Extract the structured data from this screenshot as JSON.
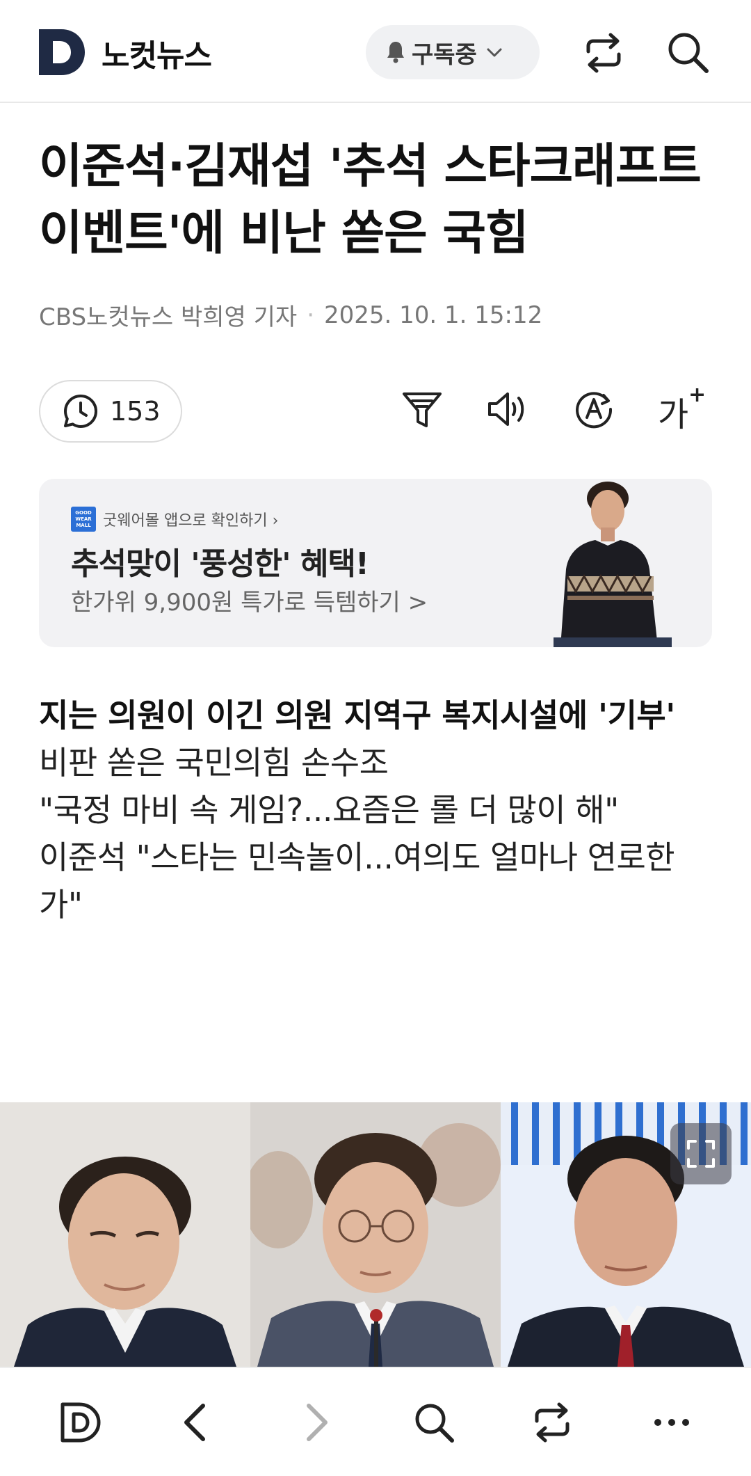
{
  "header": {
    "brand": "노컷뉴스",
    "subscribe_label": "구독중"
  },
  "article": {
    "title": "이준석·김재섭 '추석 스타크래프트 이벤트'에 비난 쏟은 국힘",
    "byline_author": "CBS노컷뉴스 박희영 기자",
    "byline_sep": "·",
    "byline_date": "2025. 10. 1. 15:12",
    "comment_count": "153",
    "font_tool_label": "가",
    "font_tool_plus": "+",
    "summary": [
      {
        "text": "지는 의원이 이긴 의원 지역구 복지시설에 '기부'",
        "bold": true
      },
      {
        "text": "비판 쏟은 국민의힘 손수조",
        "bold": false
      },
      {
        "text": "\"국정 마비 속 게임?...요즘은 롤 더 많이 해\"",
        "bold": false
      },
      {
        "text": "이준석 \"스타는 민속놀이...여의도 얼마나 연로한가\"",
        "bold": false
      }
    ]
  },
  "ad": {
    "logo_text": "GOOD WEAR MALL",
    "source": "굿웨어몰 앱으로 확인하기 ›",
    "headline": "추석맞이 '풍성한' 혜택!",
    "sub": "한가위 9,900원 특가로 득템하기 >"
  },
  "icons": {
    "header": [
      "bell-icon",
      "chevron-down-icon",
      "share-icon",
      "search-icon"
    ],
    "tools": [
      "comment-icon",
      "filter-icon",
      "speaker-icon",
      "translate-icon"
    ],
    "nav": [
      "home-logo-icon",
      "back-icon",
      "forward-icon",
      "search-icon",
      "share-icon",
      "more-icon"
    ],
    "photo": [
      "expand-icon"
    ]
  },
  "colors": {
    "brand_navy": "#1f2a44",
    "accent_blue": "#2b6fd6",
    "muted_text": "#777777"
  }
}
